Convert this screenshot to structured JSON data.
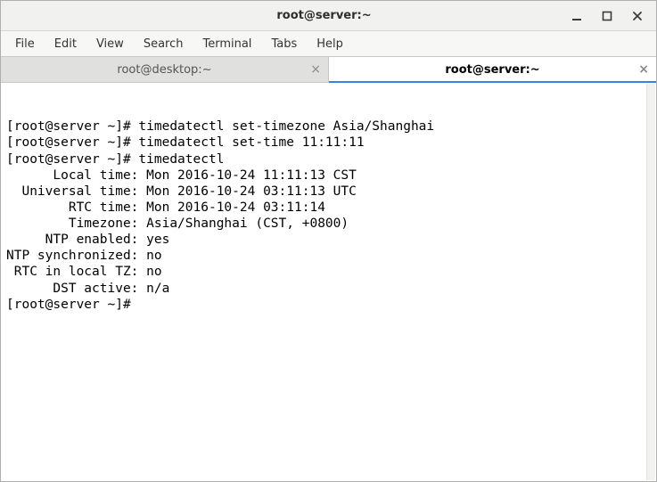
{
  "window": {
    "title": "root@server:~"
  },
  "menubar": {
    "items": [
      "File",
      "Edit",
      "View",
      "Search",
      "Terminal",
      "Tabs",
      "Help"
    ]
  },
  "tabs": [
    {
      "label": "root@desktop:~",
      "active": false
    },
    {
      "label": "root@server:~",
      "active": true
    }
  ],
  "terminal": {
    "lines": [
      "[root@server ~]# timedatectl set-timezone Asia/Shanghai",
      "[root@server ~]# timedatectl set-time 11:11:11",
      "[root@server ~]# timedatectl",
      "      Local time: Mon 2016-10-24 11:11:13 CST",
      "  Universal time: Mon 2016-10-24 03:11:13 UTC",
      "        RTC time: Mon 2016-10-24 03:11:14",
      "        Timezone: Asia/Shanghai (CST, +0800)",
      "     NTP enabled: yes",
      "NTP synchronized: no",
      " RTC in local TZ: no",
      "      DST active: n/a",
      "[root@server ~]# "
    ]
  }
}
